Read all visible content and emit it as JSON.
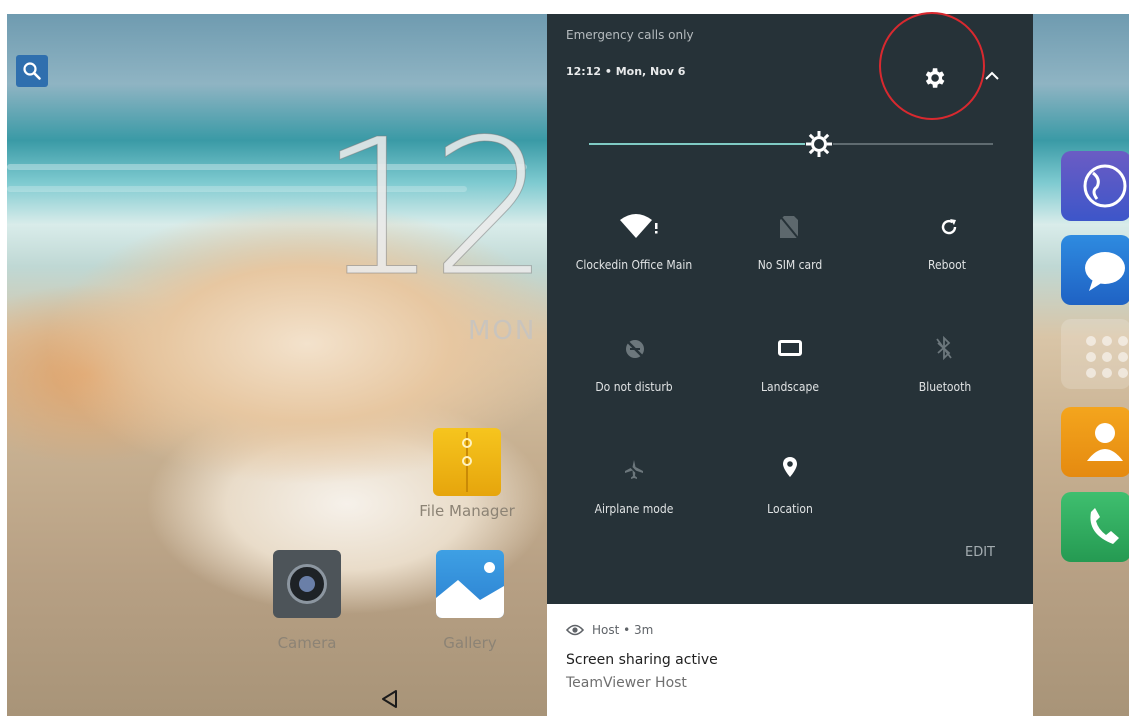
{
  "home": {
    "clock_digits": "12",
    "clock_day": "MON",
    "apps": [
      {
        "label": "File Manager",
        "icon": "file-manager-icon"
      },
      {
        "label": "Camera",
        "icon": "camera-icon"
      },
      {
        "label": "Gallery",
        "icon": "gallery-icon"
      }
    ],
    "dock": [
      "browser-icon",
      "messaging-icon",
      "app-drawer-icon",
      "contacts-icon",
      "phone-icon"
    ]
  },
  "quick_settings": {
    "carrier": "Emergency calls only",
    "time_date": "12:12 • Mon, Nov 6",
    "brightness": 0.57,
    "edit_label": "EDIT",
    "tiles": [
      {
        "label": "Clockedin Office Main",
        "icon": "wifi-icon",
        "active": true
      },
      {
        "label": "No SIM card",
        "icon": "no-sim-icon",
        "active": false
      },
      {
        "label": "Reboot",
        "icon": "reboot-icon",
        "active": true
      },
      {
        "label": "Do not disturb",
        "icon": "do-not-disturb-icon",
        "active": false
      },
      {
        "label": "Landscape",
        "icon": "landscape-icon",
        "active": true
      },
      {
        "label": "Bluetooth",
        "icon": "bluetooth-icon",
        "active": false
      },
      {
        "label": "Airplane mode",
        "icon": "airplane-icon",
        "active": false
      },
      {
        "label": "Location",
        "icon": "location-icon",
        "active": true
      }
    ]
  },
  "notification": {
    "app_line": "Host • 3m",
    "title": "Screen sharing active",
    "subtitle": "TeamViewer Host"
  },
  "colors": {
    "panel_bg": "#263238",
    "accent": "#80cbc4",
    "highlight_ring": "#d8292f"
  }
}
